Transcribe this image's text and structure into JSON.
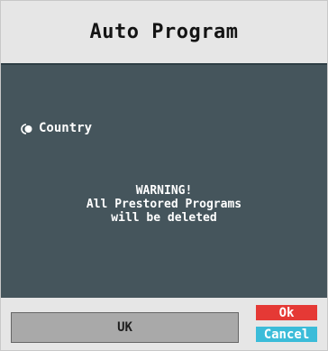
{
  "window": {
    "title": "Auto Program"
  },
  "settings": {
    "country_label": "Country",
    "country_value": "UK"
  },
  "warning": {
    "line1": "WARNING!",
    "line2": "All Prestored Programs",
    "line3": "will be deleted"
  },
  "buttons": {
    "ok_label": "Ok",
    "cancel_label": "Cancel"
  },
  "icons": {
    "radio": "radio-selected-icon"
  },
  "colors": {
    "panel": "#45555c",
    "ok": "#e53935",
    "cancel": "#3bbcd9",
    "field": "#a9a9a9"
  }
}
